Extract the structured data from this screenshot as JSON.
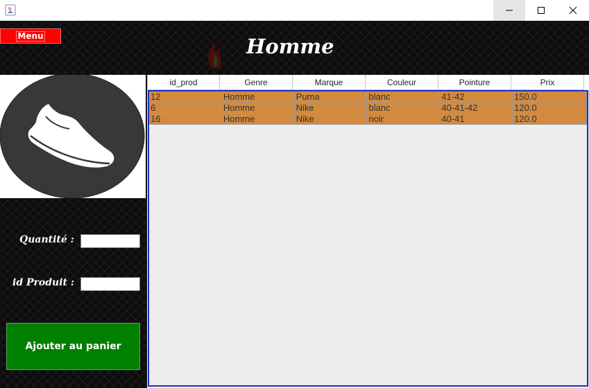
{
  "header": {
    "menu_label": "Menu",
    "title": "Homme"
  },
  "form": {
    "quantity_label": "Quantité :",
    "product_id_label": "id Produit :",
    "quantity_value": "",
    "product_id_value": "",
    "add_button_label": "Ajouter au panier"
  },
  "table": {
    "columns": [
      "id_prod",
      "Genre",
      "Marque",
      "Couleur",
      "Pointure",
      "Prix"
    ],
    "rows": [
      [
        "12",
        "Homme",
        "Puma",
        "blanc",
        "41-42",
        "150.0"
      ],
      [
        "6",
        "Homme",
        "Nike",
        "blanc",
        "40-41-42",
        "120.0"
      ],
      [
        "16",
        "Homme",
        "Nike",
        "noir",
        "40-41",
        "120.0"
      ]
    ]
  },
  "colors": {
    "menu_bg": "#ff0000",
    "add_button_bg": "#008000",
    "selected_row": "#d48a3e",
    "table_border": "#1530c4"
  },
  "icons": [
    "java-app-icon",
    "minimize-icon",
    "maximize-icon",
    "close-icon",
    "shoe-icon"
  ]
}
